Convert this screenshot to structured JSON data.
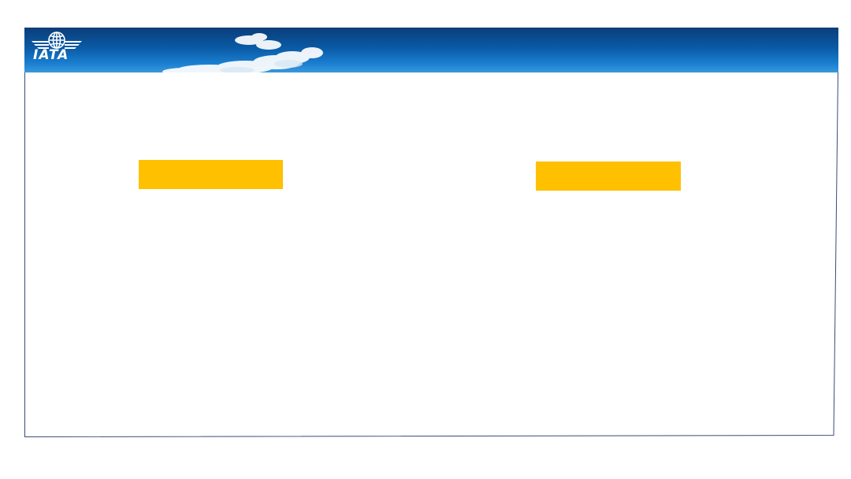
{
  "header": {
    "logo_text": "IATA",
    "banner_color_top": "#0b3d78",
    "banner_color_bottom": "#3a98dc"
  },
  "boxes": {
    "accent_color": "#ffc000",
    "left_label": "",
    "right_label": ""
  }
}
